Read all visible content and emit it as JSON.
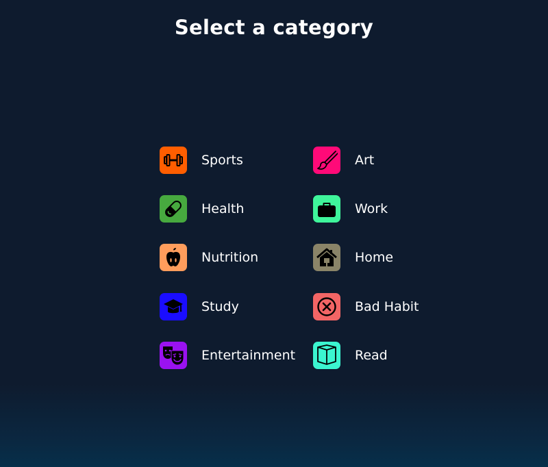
{
  "title": "Select a category",
  "categories": [
    {
      "label": "Sports",
      "icon": "dumbbell-icon",
      "color": "#ff5e00"
    },
    {
      "label": "Art",
      "icon": "paintbrush-icon",
      "color": "#ff0a78"
    },
    {
      "label": "Health",
      "icon": "pill-icon",
      "color": "#47a93f"
    },
    {
      "label": "Work",
      "icon": "briefcase-icon",
      "color": "#3ff59b"
    },
    {
      "label": "Nutrition",
      "icon": "apple-icon",
      "color": "#ff9d5c"
    },
    {
      "label": "Home",
      "icon": "house-icon",
      "color": "#8a8468"
    },
    {
      "label": "Study",
      "icon": "graduation-cap-icon",
      "color": "#1a0dff"
    },
    {
      "label": "Bad Habit",
      "icon": "x-circle-icon",
      "color": "#f26565"
    },
    {
      "label": "Entertainment",
      "icon": "theater-masks-icon",
      "color": "#9a12f0"
    },
    {
      "label": "Read",
      "icon": "book-icon",
      "color": "#3bf5cf"
    }
  ]
}
